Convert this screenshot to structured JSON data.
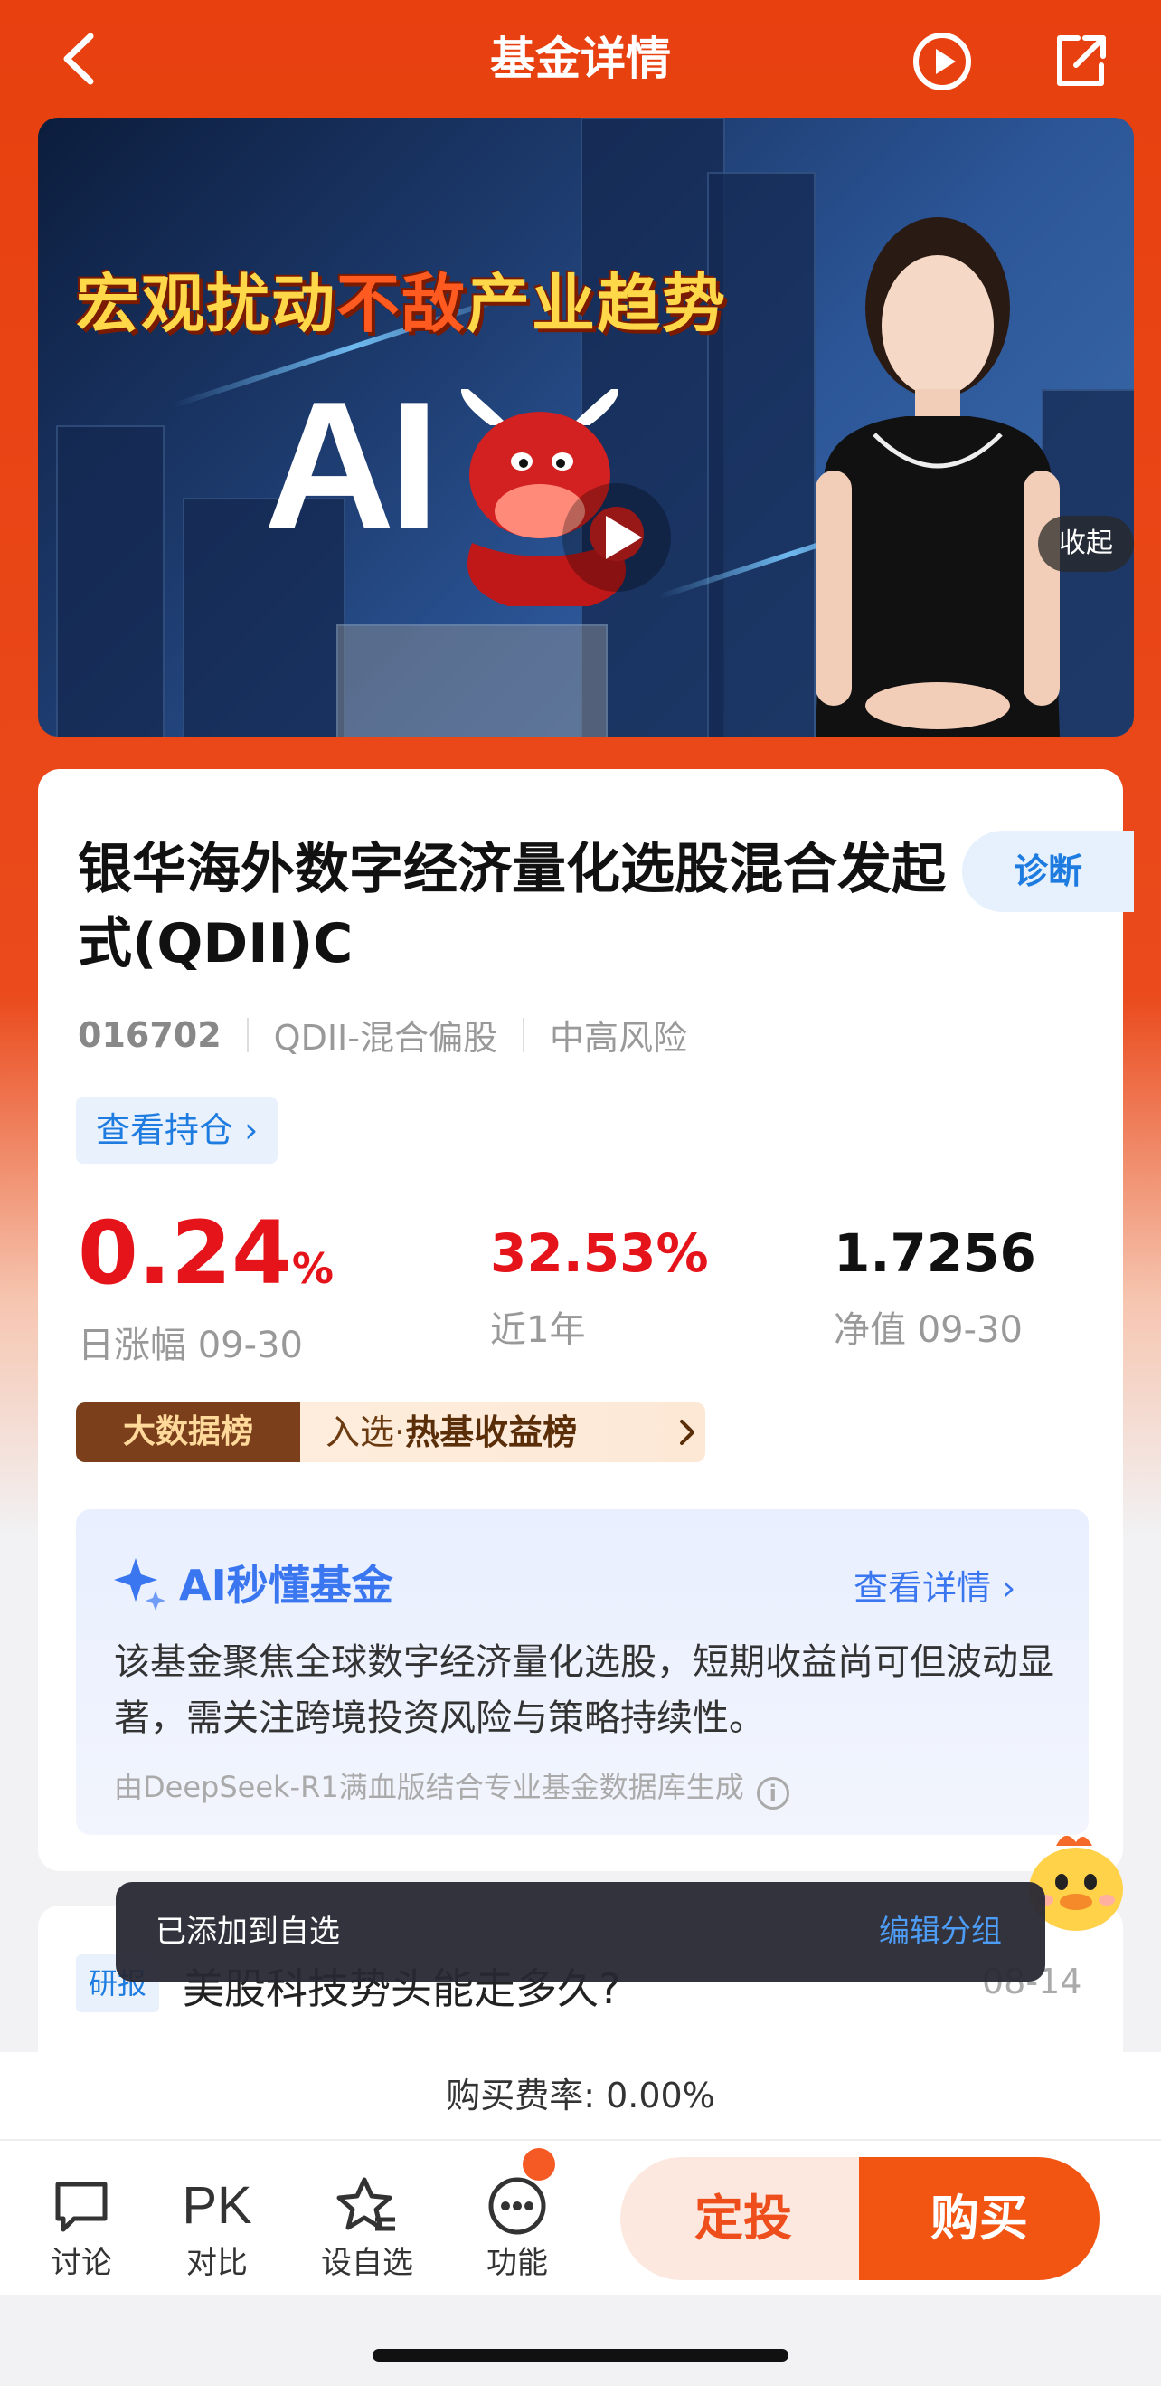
{
  "nav": {
    "title": "基金详情"
  },
  "banner": {
    "headline_part1": "宏观扰动",
    "headline_part2": "不敌",
    "headline_part3": "产业趋势",
    "ai_text": "AI",
    "collapse_label": "收起"
  },
  "fund": {
    "name": "银华海外数字经济量化选股混合发起式(QDII)C",
    "diagnose_label": "诊断",
    "code": "016702",
    "category": "QDII-混合偏股",
    "risk": "中高风险",
    "holdings_label": "查看持仓 ›"
  },
  "stats": {
    "daily_change_value": "0.24",
    "daily_change_unit": "%",
    "daily_change_label": "日涨幅 09-30",
    "one_year_value": "32.53%",
    "one_year_label": "近1年",
    "nav_value": "1.7256",
    "nav_label": "净值 09-30"
  },
  "rank": {
    "tag": "大数据榜",
    "prefix": "入选·",
    "name": "热基收益榜"
  },
  "ai_summary": {
    "title": "AI秒懂基金",
    "more_label": "查看详情 ›",
    "description": "该基金聚焦全球数字经济量化选股，短期收益尚可但波动显著，需关注跨境投资风险与策略持续性。",
    "source": "由DeepSeek-R1满血版结合专业基金数据库生成"
  },
  "report": {
    "tag": "研报",
    "title": "美股科技势头能走多久?",
    "date": "08-14"
  },
  "toast": {
    "message": "已添加到自选",
    "action": "编辑分组"
  },
  "fee": {
    "text": "购买费率: 0.00%"
  },
  "bottom_bar": {
    "discuss_label": "讨论",
    "compare_icon_text": "PK",
    "compare_label": "对比",
    "watchlist_label": "设自选",
    "function_label": "功能",
    "auto_invest_label": "定投",
    "buy_label": "购买"
  },
  "colors": {
    "brand_orange": "#e8400f",
    "rise_red": "#e5131a",
    "link_blue": "#1e7ce0",
    "ai_blue": "#3a76f0"
  }
}
